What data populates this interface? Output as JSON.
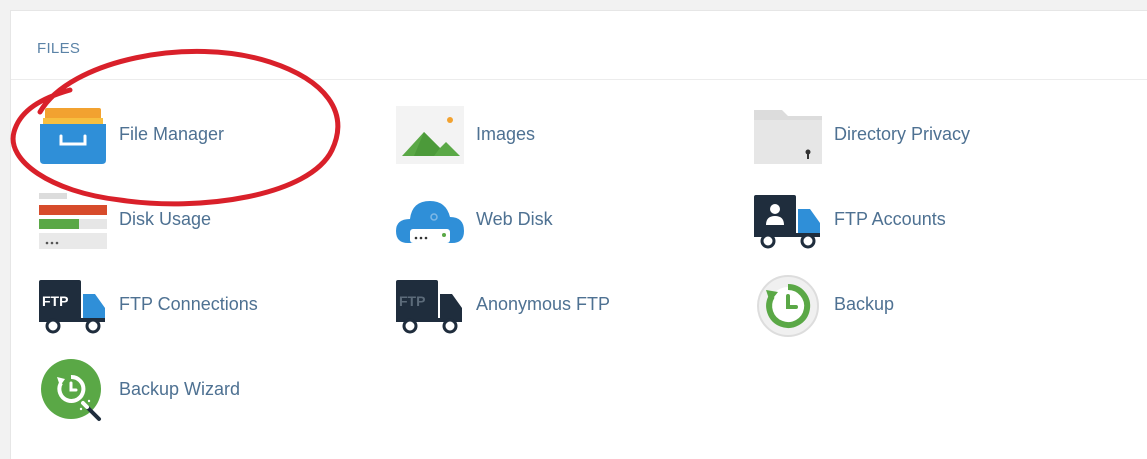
{
  "panel": {
    "title": "FILES"
  },
  "items": [
    {
      "label": "File Manager",
      "icon": "file-manager-icon"
    },
    {
      "label": "Images",
      "icon": "images-icon"
    },
    {
      "label": "Directory Privacy",
      "icon": "directory-privacy-icon"
    },
    {
      "label": "Disk Usage",
      "icon": "disk-usage-icon"
    },
    {
      "label": "Web Disk",
      "icon": "web-disk-icon"
    },
    {
      "label": "FTP Accounts",
      "icon": "ftp-accounts-icon"
    },
    {
      "label": "FTP Connections",
      "icon": "ftp-connections-icon"
    },
    {
      "label": "Anonymous FTP",
      "icon": "anonymous-ftp-icon"
    },
    {
      "label": "Backup",
      "icon": "backup-icon"
    },
    {
      "label": "Backup Wizard",
      "icon": "backup-wizard-icon"
    }
  ],
  "icon_text": {
    "ftp": "FTP"
  },
  "colors": {
    "link": "#4e7192",
    "heading": "#5b83a7",
    "annotation": "#d9202a",
    "accent_blue": "#2f8fd8",
    "accent_green": "#5aa846",
    "accent_orange": "#f2a230"
  }
}
